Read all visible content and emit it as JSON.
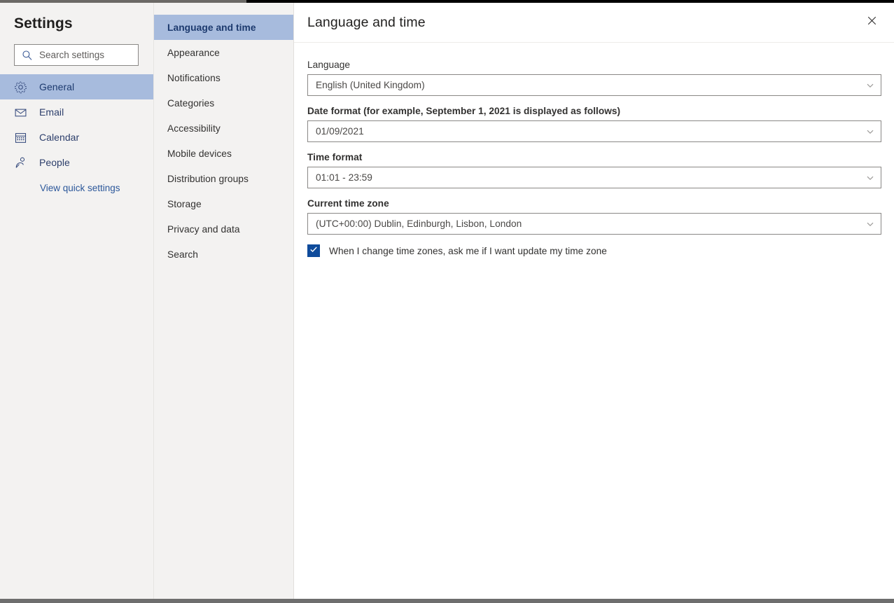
{
  "sidebar": {
    "title": "Settings",
    "search": {
      "placeholder": "Search settings",
      "value": "",
      "icon": "search-icon"
    },
    "items": [
      {
        "label": "General",
        "icon": "gear-icon",
        "selected": true
      },
      {
        "label": "Email",
        "icon": "envelope-icon",
        "selected": false
      },
      {
        "label": "Calendar",
        "icon": "calendar-icon",
        "selected": false
      },
      {
        "label": "People",
        "icon": "person-icon",
        "selected": false
      }
    ],
    "quick_settings_link": "View quick settings"
  },
  "categories": {
    "items": [
      {
        "label": "Language and time",
        "selected": true
      },
      {
        "label": "Appearance",
        "selected": false
      },
      {
        "label": "Notifications",
        "selected": false
      },
      {
        "label": "Categories",
        "selected": false
      },
      {
        "label": "Accessibility",
        "selected": false
      },
      {
        "label": "Mobile devices",
        "selected": false
      },
      {
        "label": "Distribution groups",
        "selected": false
      },
      {
        "label": "Storage",
        "selected": false
      },
      {
        "label": "Privacy and data",
        "selected": false
      },
      {
        "label": "Search",
        "selected": false
      }
    ]
  },
  "content": {
    "title": "Language and time",
    "close_icon": "close-icon",
    "fields": {
      "language": {
        "label": "Language",
        "value": "English (United Kingdom)",
        "bold_label": false
      },
      "date_format": {
        "label": "Date format (for example, September 1, 2021 is displayed as follows)",
        "value": "01/09/2021",
        "bold_label": true
      },
      "time_format": {
        "label": "Time format",
        "value": "01:01 - 23:59",
        "bold_label": false
      },
      "time_zone": {
        "label": "Current time zone",
        "value": "(UTC+00:00) Dublin, Edinburgh, Lisbon, London",
        "bold_label": false
      }
    },
    "timezone_prompt": {
      "label": "When I change time zones, ask me if I want update my time zone",
      "checked": true
    }
  },
  "colors": {
    "panel_bg": "#f3f2f1",
    "selection_bg": "#a7bbdd",
    "link": "#2b579a",
    "checkbox_fill": "#0f4b9b",
    "text": "#323130"
  }
}
